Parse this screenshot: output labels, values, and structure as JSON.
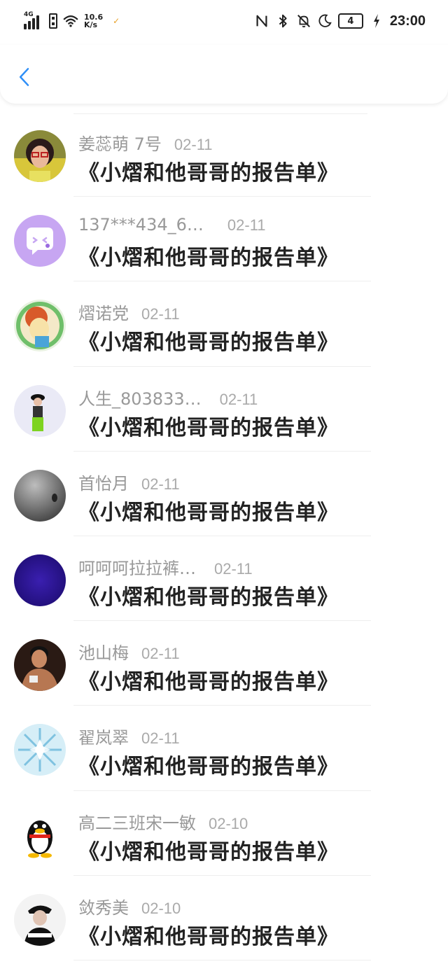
{
  "status_bar": {
    "network_type": "4G",
    "net_speed_value": "10.6",
    "net_speed_unit": "K/s",
    "battery": "4",
    "time": "23:00"
  },
  "header": {
    "back_icon": "chevron-left-icon",
    "accent_color": "#2f8ff7"
  },
  "comments": [
    {
      "name": "姜蕊萌 7号",
      "date": "02-11",
      "title": "《小熠和他哥哥的报告单》"
    },
    {
      "name": "137***434_6…",
      "date": "02-11",
      "title": "《小熠和他哥哥的报告单》"
    },
    {
      "name": "熠诺党",
      "date": "02-11",
      "title": "《小熠和他哥哥的报告单》"
    },
    {
      "name": "人生_803833…",
      "date": "02-11",
      "title": "《小熠和他哥哥的报告单》"
    },
    {
      "name": "首怡月",
      "date": "02-11",
      "title": "《小熠和他哥哥的报告单》"
    },
    {
      "name": "呵呵呵拉拉裤…",
      "date": "02-11",
      "title": "《小熠和他哥哥的报告单》"
    },
    {
      "name": "池山梅",
      "date": "02-11",
      "title": "《小熠和他哥哥的报告单》"
    },
    {
      "name": "翟岚翠",
      "date": "02-11",
      "title": "《小熠和他哥哥的报告单》"
    },
    {
      "name": "高二三班宋一敏",
      "date": "02-10",
      "title": "《小熠和他哥哥的报告单》"
    },
    {
      "name": "敛秀美",
      "date": "02-10",
      "title": "《小熠和他哥哥的报告单》"
    }
  ]
}
